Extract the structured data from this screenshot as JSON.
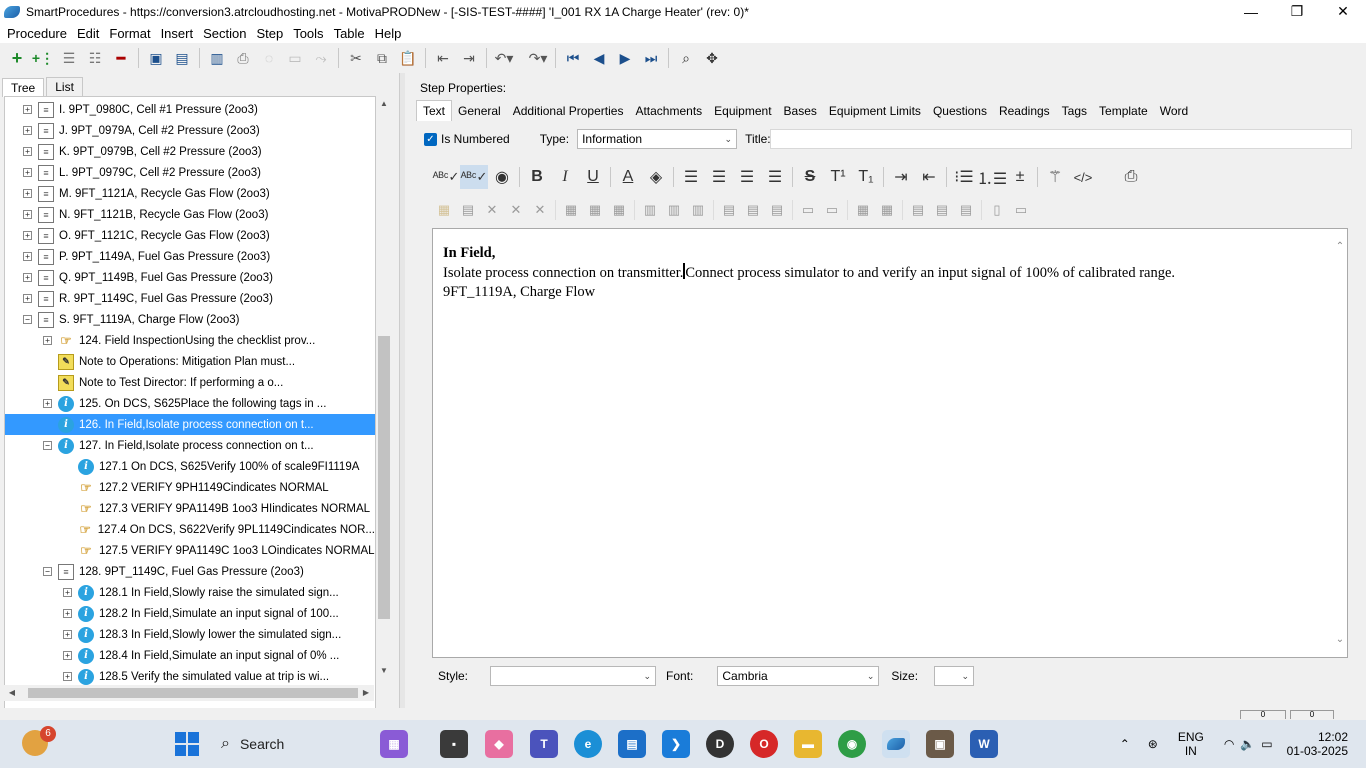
{
  "window": {
    "title": "SmartProcedures - https://conversion3.atrcloudhosting.net - MotivaPRODNew - [-SIS-TEST-####] 'I_001 RX 1A Charge Heater' (rev: 0)*",
    "controls": [
      "—",
      "❐",
      "✕"
    ]
  },
  "menu": [
    "Procedure",
    "Edit",
    "Format",
    "Insert",
    "Section",
    "Step",
    "Tools",
    "Table",
    "Help"
  ],
  "left_tabs": [
    "Tree",
    "List"
  ],
  "tree": [
    {
      "text": "I. 9PT_0980C, Cell #1 Pressure (2oo3)",
      "expander": "+",
      "icon": "list",
      "indent": 0
    },
    {
      "text": "J. 9PT_0979A, Cell #2 Pressure (2oo3)",
      "expander": "+",
      "icon": "list",
      "indent": 0
    },
    {
      "text": "K. 9PT_0979B, Cell #2 Pressure (2oo3)",
      "expander": "+",
      "icon": "list",
      "indent": 0
    },
    {
      "text": "L. 9PT_0979C, Cell #2 Pressure (2oo3)",
      "expander": "+",
      "icon": "list",
      "indent": 0
    },
    {
      "text": "M. 9FT_1121A, Recycle Gas Flow (2oo3)",
      "expander": "+",
      "icon": "list",
      "indent": 0
    },
    {
      "text": "N. 9FT_1121B, Recycle Gas Flow (2oo3)",
      "expander": "+",
      "icon": "list",
      "indent": 0
    },
    {
      "text": "O. 9FT_1121C, Recycle Gas Flow (2oo3)",
      "expander": "+",
      "icon": "list",
      "indent": 0
    },
    {
      "text": "P. 9PT_1149A, Fuel Gas Pressure (2oo3)",
      "expander": "+",
      "icon": "list",
      "indent": 0
    },
    {
      "text": "Q. 9PT_1149B, Fuel Gas Pressure (2oo3)",
      "expander": "+",
      "icon": "list",
      "indent": 0
    },
    {
      "text": "R. 9PT_1149C, Fuel Gas Pressure (2oo3)",
      "expander": "+",
      "icon": "list",
      "indent": 0
    },
    {
      "text": "S. 9FT_1119A, Charge Flow (2oo3)",
      "expander": "−",
      "icon": "list",
      "indent": 0
    },
    {
      "text": "124. Field InspectionUsing the checklist prov...",
      "expander": "+",
      "icon": "hand",
      "indent": 1
    },
    {
      "text": "Note to Operations: Mitigation Plan must...",
      "expander": "",
      "icon": "note",
      "indent": 1
    },
    {
      "text": "Note to Test Director: If performing a o...",
      "expander": "",
      "icon": "note",
      "indent": 1
    },
    {
      "text": "125. On DCS, S625Place the following tags in ...",
      "expander": "+",
      "icon": "info",
      "indent": 1
    },
    {
      "text": "126. In Field,Isolate process connection on t...",
      "expander": "",
      "icon": "info",
      "indent": 1,
      "selected": true
    },
    {
      "text": "127. In Field,Isolate process connection on t...",
      "expander": "−",
      "icon": "info",
      "indent": 1
    },
    {
      "text": "127.1 On DCS, S625Verify 100% of scale9FI1119A",
      "expander": "",
      "icon": "info",
      "indent": 2
    },
    {
      "text": "127.2 VERIFY 9PH1149Cindicates NORMAL",
      "expander": "",
      "icon": "hand",
      "indent": 2
    },
    {
      "text": "127.3 VERIFY 9PA1149B 1oo3 HIindicates NORMAL",
      "expander": "",
      "icon": "hand",
      "indent": 2
    },
    {
      "text": "127.4 On DCS, S622Verify 9PL1149Cindicates NOR...",
      "expander": "",
      "icon": "hand",
      "indent": 2
    },
    {
      "text": "127.5 VERIFY 9PA1149C 1oo3 LOindicates NORMAL",
      "expander": "",
      "icon": "hand",
      "indent": 2
    },
    {
      "text": "128. 9PT_1149C, Fuel Gas Pressure (2oo3)",
      "expander": "−",
      "icon": "list",
      "indent": 1
    },
    {
      "text": "128.1 In Field,Slowly raise the simulated sign...",
      "expander": "+",
      "icon": "info",
      "indent": 2
    },
    {
      "text": "128.2 In Field,Simulate an input signal of 100...",
      "expander": "+",
      "icon": "info",
      "indent": 2
    },
    {
      "text": "128.3 In Field,Slowly lower the simulated sign...",
      "expander": "+",
      "icon": "info",
      "indent": 2
    },
    {
      "text": "128.4 In Field,Simulate an input signal of 0% ...",
      "expander": "+",
      "icon": "info",
      "indent": 2
    },
    {
      "text": "128.5 Verify the simulated value at trip is wi...",
      "expander": "+",
      "icon": "info",
      "indent": 2
    }
  ],
  "step_properties": {
    "label": "Step Properties:",
    "tabs": [
      "Text",
      "General",
      "Additional Properties",
      "Attachments",
      "Equipment",
      "Bases",
      "Equipment Limits",
      "Questions",
      "Readings",
      "Tags",
      "Template",
      "Word"
    ],
    "is_numbered_label": "Is Numbered",
    "type_label": "Type:",
    "type_value": "Information",
    "title_label": "Title:",
    "title_value": ""
  },
  "editor": {
    "line1": "In Field,",
    "line2a": "Isolate process connection on transmitter.",
    "line2b": "Connect process simulator to and verify an input signal of 100% of calibrated range.",
    "line3": "9FT_1119A, Charge Flow"
  },
  "bottom": {
    "style_label": "Style:",
    "style_value": "",
    "font_label": "Font:",
    "font_value": "Cambria",
    "size_label": "Size:",
    "size_value": ""
  },
  "statusbar": [
    "0",
    "0"
  ],
  "taskbar": {
    "weather_badge": "6",
    "search_placeholder": "Search",
    "lang_top": "ENG",
    "lang_bottom": "IN",
    "time": "12:02",
    "date": "01-03-2025"
  }
}
